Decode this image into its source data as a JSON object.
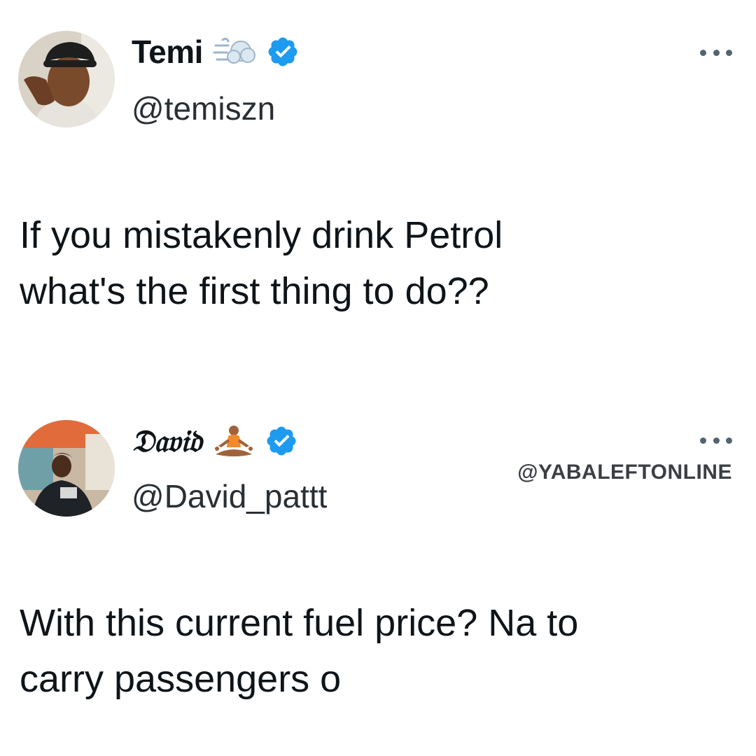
{
  "tweets": [
    {
      "display_name": "Temi",
      "name_emoji": "dash-emoji",
      "verified": true,
      "handle": "@temiszn",
      "text_lines": [
        "If you mistakenly drink Petrol",
        "what's the first thing to do??"
      ]
    },
    {
      "display_name": "𝔇𝔞𝔳𝔦𝔡",
      "name_emoji": "person-in-lotus-position-emoji",
      "verified": true,
      "handle": "@David_pattt",
      "text_lines": [
        "With this current fuel price? Na to",
        "carry passengers o"
      ]
    }
  ],
  "watermark": "@YABALEFTONLINE",
  "colors": {
    "verified_blue": "#1d9bf0",
    "text": "#0f1419",
    "secondary": "#536471"
  },
  "icons": {
    "more": "more-horizontal-icon",
    "verified": "verified-badge-icon"
  }
}
